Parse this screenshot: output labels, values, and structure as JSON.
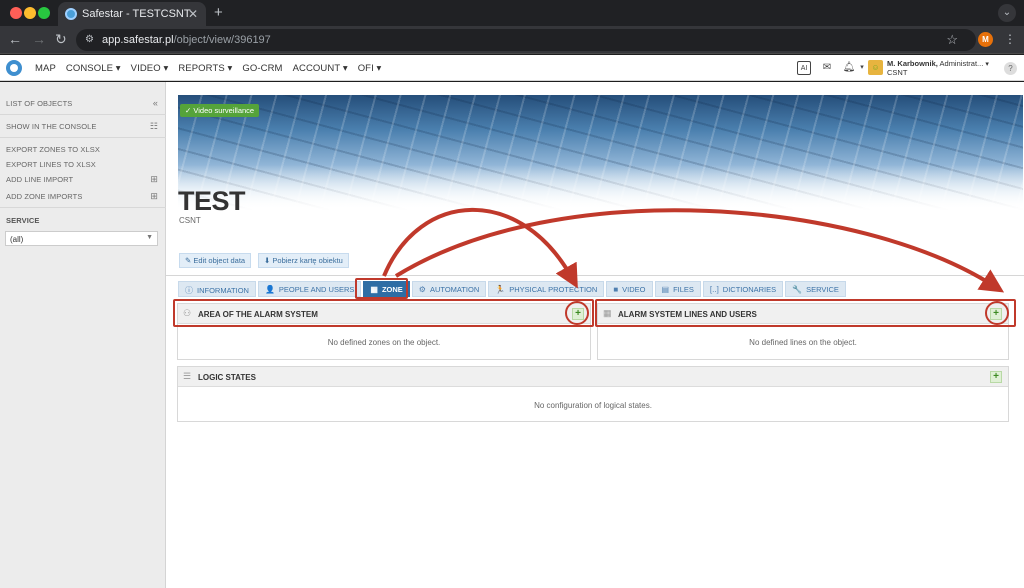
{
  "browser": {
    "tab_title": "Safestar - TESTCSNT",
    "url_host": "app.safestar.pl",
    "url_path": "/object/view/396197",
    "profile_initial": "M"
  },
  "nav": {
    "items": [
      "MAP",
      "CONSOLE ▾",
      "VIDEO ▾",
      "REPORTS ▾",
      "GO-CRM",
      "ACCOUNT ▾",
      "OFI ▾"
    ],
    "user_name": "M. Karbownik,",
    "user_role": "Administrat...",
    "user_org": "CSNT"
  },
  "sidebar": {
    "list_of_objects": "LIST OF OBJECTS",
    "show_in_console": "SHOW IN THE CONSOLE",
    "export_zones": "EXPORT ZONES TO XLSX",
    "export_lines": "EXPORT LINES TO XLSX",
    "add_line_import": "ADD LINE IMPORT",
    "add_zone_imports": "ADD ZONE IMPORTS",
    "service_label": "SERVICE",
    "service_value": "(all)"
  },
  "object": {
    "badge": "✓ Video surveillance",
    "title": "TEST",
    "subtitle": "CSNT",
    "edit_button": "Edit object data",
    "download_button": "Pobierz kartę obiektu"
  },
  "tabs": [
    {
      "label": "INFORMATION",
      "icon": "ⓘ"
    },
    {
      "label": "PEOPLE AND USERS",
      "icon": "👤"
    },
    {
      "label": "ZONE",
      "icon": "▦"
    },
    {
      "label": "AUTOMATION",
      "icon": "⚙"
    },
    {
      "label": "PHYSICAL PROTECTION",
      "icon": "🏃"
    },
    {
      "label": "VIDEO",
      "icon": "■"
    },
    {
      "label": "FILES",
      "icon": "▤"
    },
    {
      "label": "DICTIONARIES",
      "icon": "[..]"
    },
    {
      "label": "SERVICE",
      "icon": "🔧"
    }
  ],
  "panels": {
    "area": {
      "title": "AREA OF THE ALARM SYSTEM",
      "empty": "No defined zones on the object."
    },
    "lines": {
      "title": "ALARM SYSTEM LINES AND USERS",
      "empty": "No defined lines on the object."
    },
    "logic": {
      "title": "LOGIC STATES",
      "empty": "No configuration of logical states."
    }
  },
  "colors": {
    "annotation": "#c0392b",
    "active_tab": "#2e6da4",
    "badge": "#55a33a"
  }
}
